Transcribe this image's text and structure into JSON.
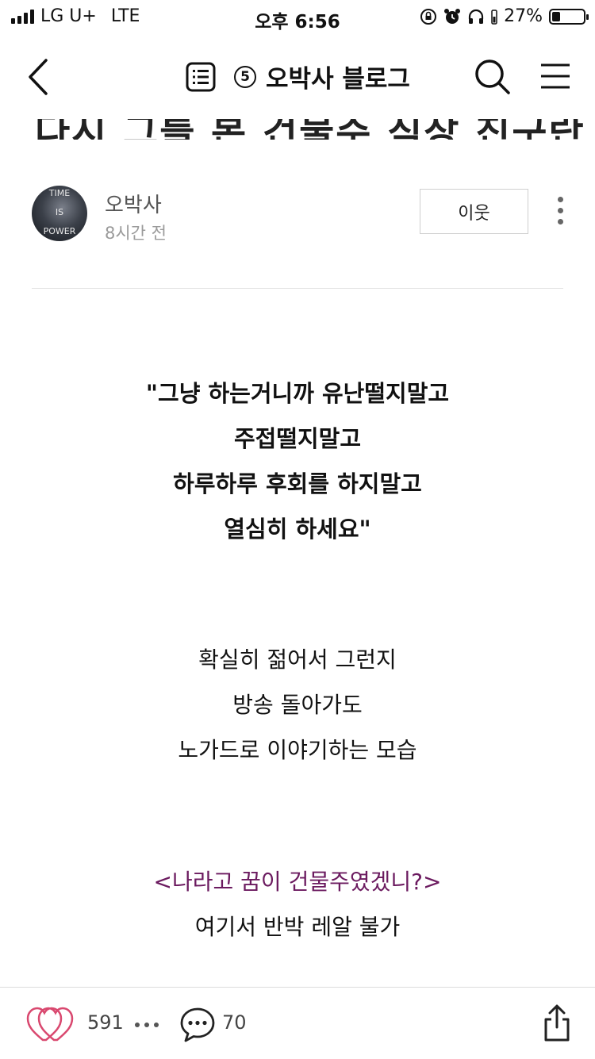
{
  "status_bar": {
    "carrier": "LG U+",
    "network": "LTE",
    "time": "오후 6:56",
    "battery": "27%",
    "battery_level": 0.27
  },
  "nav": {
    "blog_number": "5",
    "title": "오박사 블로그"
  },
  "post": {
    "clipped_title": "다시 그를 본 건물주 직장 친구란"
  },
  "author": {
    "avatar_text": [
      "TIME",
      "IS",
      "POWER"
    ],
    "name": "오박사",
    "time": "8시간 전",
    "follow_label": "이웃"
  },
  "body": {
    "quote_lines": [
      "\"그냥 하는거니까 유난떨지말고",
      "주접떨지말고",
      "하루하루 후회를 하지말고",
      "열심히 하세요\""
    ],
    "para2_lines": [
      "확실히 젊어서 그런지",
      "방송 돌아가도",
      "노가드로 이야기하는 모습"
    ],
    "purple_line": "<나라고 꿈이 건물주였겠니?>",
    "final_line": "여기서 반박 레알 불가"
  },
  "bottom_bar": {
    "like_count": "591",
    "comment_count": "70"
  },
  "colors": {
    "purple_text": "#6b1a5f",
    "heart": "#d9486f"
  }
}
